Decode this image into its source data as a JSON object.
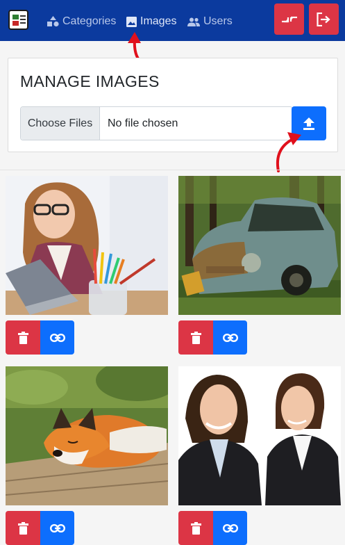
{
  "nav": {
    "categories_label": "Categories",
    "images_label": "Images",
    "users_label": "Users"
  },
  "card": {
    "title": "MANAGE IMAGES",
    "choose_files_label": "Choose Files",
    "file_status": "No file chosen"
  },
  "images": [
    {
      "subject": "woman with pencils at laptop"
    },
    {
      "subject": "abandoned rusty car in forest"
    },
    {
      "subject": "sleeping fox on wooden plank"
    },
    {
      "subject": "two businesswomen looking right"
    }
  ],
  "colors": {
    "navbar": "#0b3a9e",
    "danger": "#dc3545",
    "primary": "#0d6efd",
    "annotation_arrow": "#e0101c"
  },
  "icons": {
    "categories": "shapes-icon",
    "images": "image-icon",
    "users": "users-icon",
    "compress": "compress-icon",
    "logout": "logout-icon",
    "upload": "upload-icon",
    "delete": "trash-icon",
    "copy_link": "link-icon"
  }
}
